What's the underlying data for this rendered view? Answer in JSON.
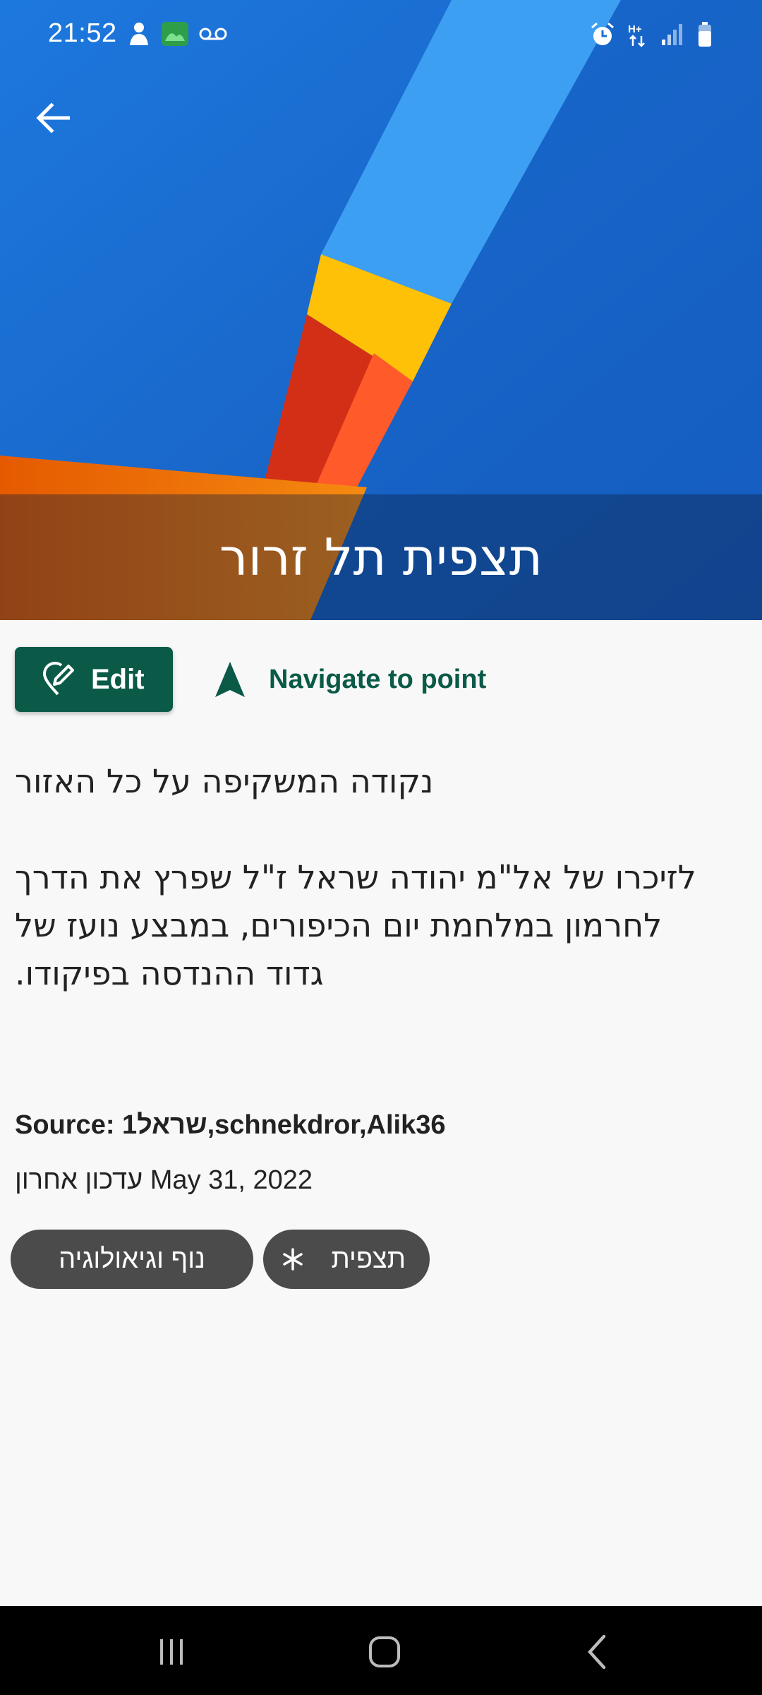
{
  "status_bar": {
    "time": "21:52",
    "left_icons": [
      "person-notification-icon",
      "gallery-notification-icon",
      "voicemail-icon"
    ],
    "right_icons": [
      "alarm-icon",
      "hplus-data-icon",
      "signal-icon",
      "battery-icon"
    ]
  },
  "header": {
    "title": "תצפית תל זרור",
    "back_icon": "arrow-back-icon"
  },
  "actions": {
    "edit_label": "Edit",
    "navigate_label": "Navigate to point"
  },
  "description": "נקודה המשקיפה על כל האזור\n\nלזיכרו של אל\"מ יהודה שראל ז\"ל שפרץ את הדרך לחרמון במלחמת יום הכיפורים, במבצע נועז של גדוד ההנדסה בפיקודו.",
  "source_text": "Source: 1שראל,schnekdror,Alik36",
  "updated_text": "עדכון אחרון May 31, 2022",
  "chips": [
    {
      "label": "נוף וגיאולוגיה"
    },
    {
      "label": "תצפית",
      "icon": "asterisk-icon"
    }
  ],
  "colors": {
    "accent": "#0b5a48",
    "chip": "#4b4b4b",
    "header_blue": "#1a6fd0"
  }
}
